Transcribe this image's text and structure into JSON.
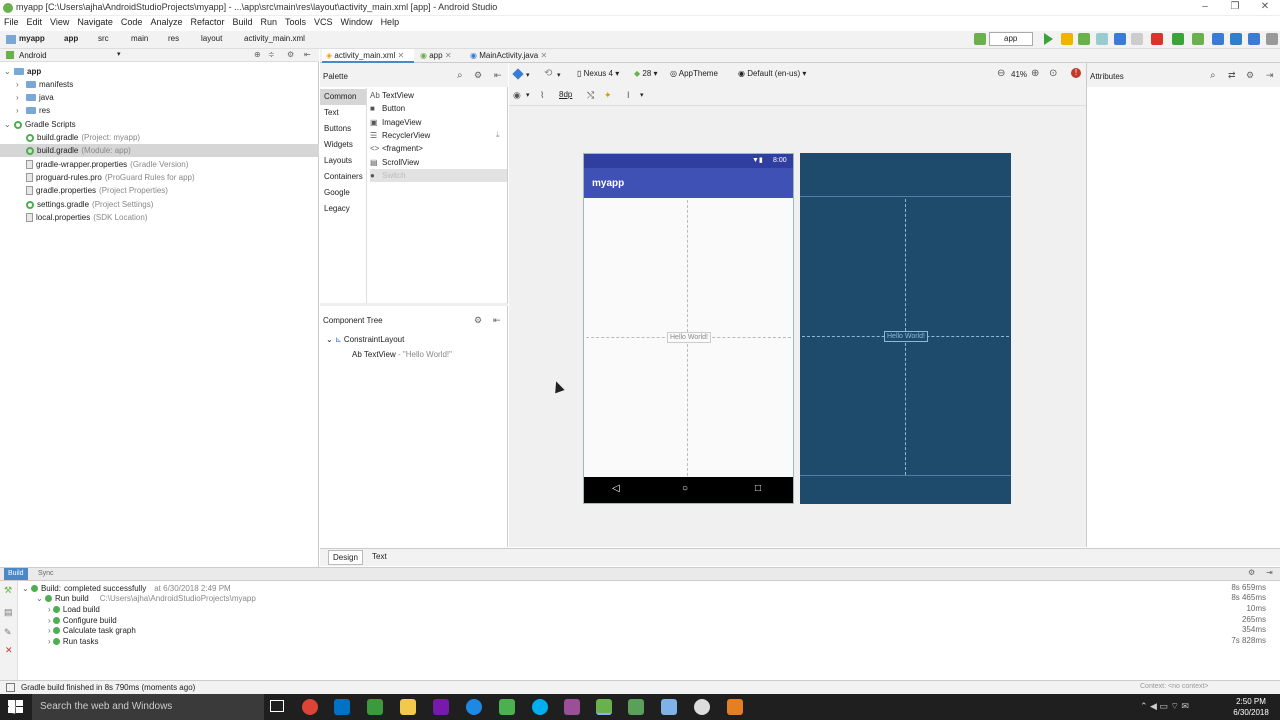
{
  "window": {
    "title": "myapp [C:\\Users\\ajha\\AndroidStudioProjects\\myapp] - ...\\app\\src\\main\\res\\layout\\activity_main.xml [app] - Android Studio"
  },
  "menu": [
    "File",
    "Edit",
    "View",
    "Navigate",
    "Code",
    "Analyze",
    "Refactor",
    "Build",
    "Run",
    "Tools",
    "VCS",
    "Window",
    "Help"
  ],
  "breadcrumb": [
    "myapp",
    "app",
    "src",
    "main",
    "res",
    "layout",
    "activity_main.xml"
  ],
  "run_config": "app",
  "project": {
    "view": "Android",
    "items": [
      {
        "label": "app",
        "note": "",
        "icon": "module"
      },
      {
        "label": "manifests",
        "note": "",
        "icon": "folder"
      },
      {
        "label": "java",
        "note": "",
        "icon": "folder"
      },
      {
        "label": "res",
        "note": "",
        "icon": "folder"
      },
      {
        "label": "Gradle Scripts",
        "note": "",
        "icon": "gradle"
      },
      {
        "label": "build.gradle",
        "note": "(Project: myapp)",
        "icon": "gradle"
      },
      {
        "label": "build.gradle",
        "note": "(Module: app)",
        "icon": "gradle"
      },
      {
        "label": "gradle-wrapper.properties",
        "note": "(Gradle Version)",
        "icon": "file"
      },
      {
        "label": "proguard-rules.pro",
        "note": "(ProGuard Rules for app)",
        "icon": "file"
      },
      {
        "label": "gradle.properties",
        "note": "(Project Properties)",
        "icon": "file"
      },
      {
        "label": "settings.gradle",
        "note": "(Project Settings)",
        "icon": "gradle"
      },
      {
        "label": "local.properties",
        "note": "(SDK Location)",
        "icon": "file"
      }
    ]
  },
  "tabs": [
    "activity_main.xml",
    "app",
    "MainActivity.java"
  ],
  "palette": {
    "title": "Palette",
    "categories": [
      "Common",
      "Text",
      "Buttons",
      "Widgets",
      "Layouts",
      "Containers",
      "Google",
      "Legacy"
    ],
    "items": [
      {
        "icon": "Ab",
        "label": "TextView"
      },
      {
        "icon": "■",
        "label": "Button"
      },
      {
        "icon": "▣",
        "label": "ImageView"
      },
      {
        "icon": "☰",
        "label": "RecyclerView"
      },
      {
        "icon": "<>",
        "label": "<fragment>"
      },
      {
        "icon": "▤",
        "label": "ScrollView"
      },
      {
        "icon": "●",
        "label": "Switch"
      }
    ]
  },
  "component_tree": {
    "title": "Component Tree",
    "root": "ConstraintLayout",
    "child": "TextView",
    "child_text": "- \"Hello World!\""
  },
  "design_toolbar": {
    "device": "Nexus 4",
    "api": "28",
    "theme": "AppTheme",
    "locale": "Default (en-us)",
    "zoom": "41%",
    "margin": "8dp"
  },
  "phone": {
    "time": "8:00",
    "app_name": "myapp",
    "hello": "Hello World!"
  },
  "attributes": {
    "title": "Attributes"
  },
  "editor_tabs": [
    "Design",
    "Text"
  ],
  "build": {
    "tabs": [
      "Build",
      "Sync"
    ],
    "rows": [
      {
        "label": "Build:",
        "extra": "completed successfully",
        "note": "at 6/30/2018 2:49 PM",
        "dur": "8s 659ms"
      },
      {
        "label": "Run build",
        "extra": "",
        "note": "C:\\Users\\ajha\\AndroidStudioProjects\\myapp",
        "dur": "8s 465ms"
      },
      {
        "label": "Load build",
        "extra": "",
        "note": "",
        "dur": "10ms"
      },
      {
        "label": "Configure build",
        "extra": "",
        "note": "",
        "dur": "265ms"
      },
      {
        "label": "Calculate task graph",
        "extra": "",
        "note": "",
        "dur": "354ms"
      },
      {
        "label": "Run tasks",
        "extra": "",
        "note": "",
        "dur": "7s 828ms"
      }
    ]
  },
  "status": {
    "message": "Gradle build finished in 8s 790ms (moments ago)",
    "context": "Context: <no context>"
  },
  "taskbar": {
    "search": "Search the web and Windows",
    "time": "2:50 PM",
    "date": "6/30/2018"
  }
}
